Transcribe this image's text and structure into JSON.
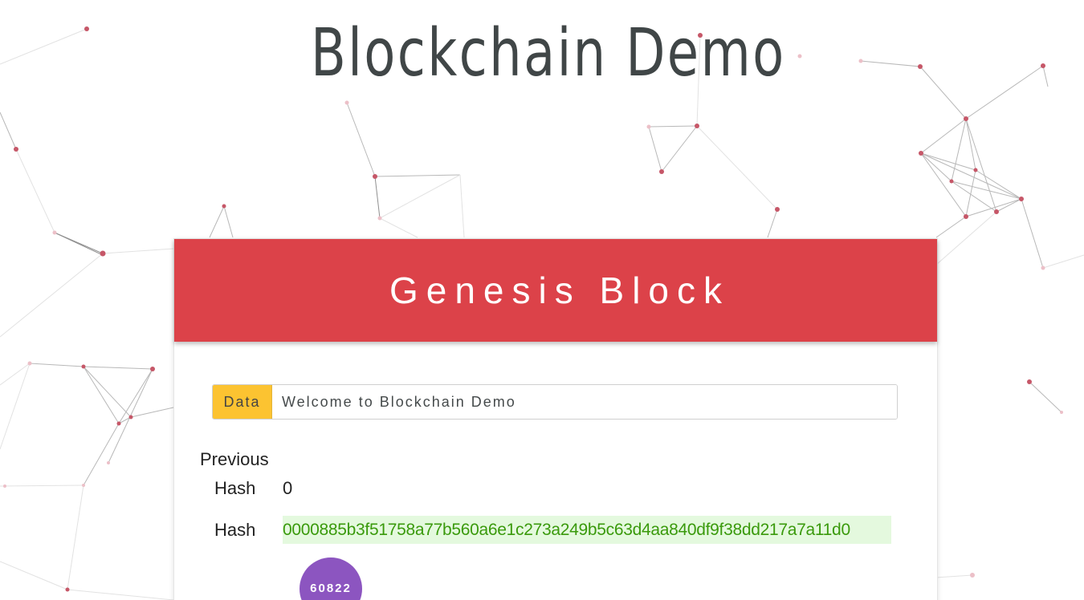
{
  "header": {
    "title": "Blockchain Demo"
  },
  "block": {
    "title": "Genesis Block",
    "data_label": "Data",
    "data_value": "Welcome to Blockchain Demo",
    "previous_label_line1": "Previous",
    "previous_label_line2": "Hash",
    "previous_hash": "0",
    "hash_label": "Hash",
    "hash_value": "0000885b3f51758a77b560a6e1c273a249b5c63d4aa840df9f38dd217a7a11d0",
    "nonce": "60822"
  },
  "colors": {
    "header_bg": "#dc4249",
    "data_addon_bg": "#fcc331",
    "hash_bg": "#e4f9de",
    "hash_text": "#3a9a0c",
    "nonce_bg": "#8c55c0",
    "title_text": "#404647"
  }
}
